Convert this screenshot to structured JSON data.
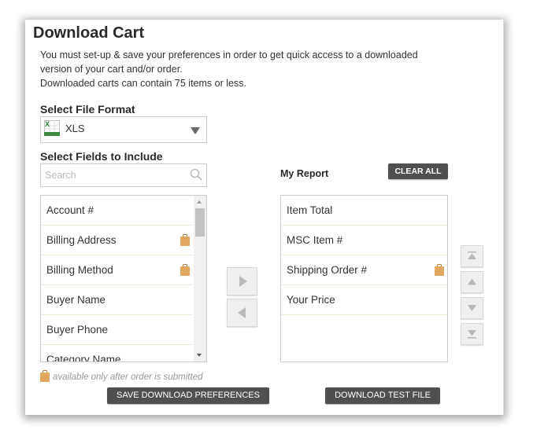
{
  "title": "Download Cart",
  "description": [
    "You must set-up & save your preferences in order to get quick access to a downloaded",
    "version of your cart and/or order.",
    "Downloaded carts can contain 75 items or less."
  ],
  "file_format": {
    "label": "Select File Format",
    "selected": "XLS",
    "icon": "excel-xls-icon"
  },
  "fields": {
    "label": "Select Fields to Include",
    "search_placeholder": "Search",
    "items": [
      {
        "label": "Account #",
        "restricted": false
      },
      {
        "label": "Billing Address",
        "restricted": true
      },
      {
        "label": "Billing Method",
        "restricted": true
      },
      {
        "label": "Buyer Name",
        "restricted": false
      },
      {
        "label": "Buyer Phone",
        "restricted": false
      },
      {
        "label": "Category Name",
        "restricted": false
      }
    ]
  },
  "report": {
    "label": "My Report",
    "clear_all": "CLEAR ALL",
    "items": [
      {
        "label": "Item Total",
        "restricted": false
      },
      {
        "label": "MSC Item #",
        "restricted": false
      },
      {
        "label": "Shipping Order #",
        "restricted": true
      },
      {
        "label": "Your Price",
        "restricted": false
      }
    ]
  },
  "note": "available only after order is submitted",
  "buttons": {
    "save": "SAVE DOWNLOAD PREFERENCES",
    "download_test": "DOWNLOAD TEST FILE"
  },
  "colors": {
    "bag_icon": "#e0a75e",
    "dark_button": "#505050",
    "excel_green": "#2e7d32"
  }
}
